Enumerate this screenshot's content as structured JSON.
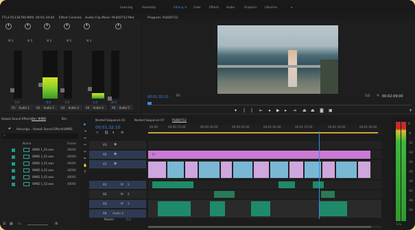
{
  "workspaces": [
    "Learning",
    "Assembly",
    "Editing",
    "Color",
    "Effects",
    "Audio",
    "Graphics",
    "Libraries"
  ],
  "active_workspace": "Editing",
  "more_glyph": "»",
  "panels": {
    "source_name": "FTL2-P1116794.MP4: 00:01:34:04",
    "effect_controls": "Effect Controls",
    "audio_clip_mixer": "Audio Clip Mixer: PL600712",
    "metadata_tab": "Met",
    "program": "Program: PL600712"
  },
  "mixer": {
    "channels": [
      {
        "label": "Audio 1",
        "track": "A1",
        "value": "0.0",
        "level": 0.0
      },
      {
        "label": "Audio 2",
        "track": "A2",
        "value": "-6.8",
        "level": 0.45
      },
      {
        "label": "Audio 3",
        "track": "A3",
        "value": "0.0",
        "level": 0.0
      },
      {
        "label": "Audio 4",
        "track": "A4",
        "value": "-1.4",
        "level": 0.12
      },
      {
        "label": "Audio 5",
        "track": "A5",
        "value": "-39.2",
        "level": 0.0
      }
    ],
    "lr": "L  R",
    "ms": "M  S"
  },
  "program": {
    "timecode": "00:01:32:10",
    "fit": "Fit",
    "zoom": "1/2",
    "duration": "00:02:09:00"
  },
  "effects": {
    "tabs": [
      "Hawaii Sound Effects",
      "Bin: WIND",
      "Bin:"
    ],
    "folder": "Hanunga... Hawaii Sound Effects\\WIND",
    "columns": [
      "Name",
      "Frame"
    ],
    "files": [
      {
        "name": "WIND 1_01.wav",
        "rate": "48000"
      },
      {
        "name": "WIND 2_01.wav",
        "rate": "48000"
      },
      {
        "name": "WIND 3_01.wav",
        "rate": "48000"
      },
      {
        "name": "WIND 4_01.wav",
        "rate": "48000"
      },
      {
        "name": "WIND 5_01.wav",
        "rate": "48000"
      },
      {
        "name": "WIND 1_02.wav",
        "rate": "48000"
      }
    ]
  },
  "timeline": {
    "tabs": [
      "Nested Sequence 01",
      "Nested Sequence 07",
      "PL600712"
    ],
    "timecode": "00:01:32:10",
    "ruler": [
      "00:00",
      "00:00:15:00",
      "00:00:30:00",
      "00:00:45:00",
      "00:01:00:00",
      "00:01:15:00",
      "00:01:30:00",
      "00:01:45:00"
    ],
    "tracks": [
      "V3",
      "V2",
      "V1",
      "A1",
      "A2",
      "A3",
      "A4"
    ],
    "a4_name": "Audio 4",
    "master": "Master",
    "master_value": "0.0",
    "mute": "M",
    "solo": "S",
    "v2_clip": "fx"
  },
  "right_meter": {
    "labels": [
      "0",
      "-6",
      "-12",
      "-18",
      "-24",
      "-30",
      "-36",
      "-42",
      "-48",
      "-54"
    ],
    "solo": "S  S"
  }
}
